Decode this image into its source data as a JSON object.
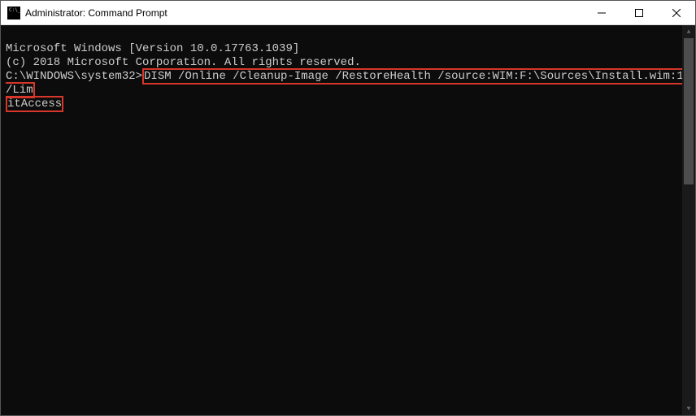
{
  "titlebar": {
    "title": "Administrator: Command Prompt"
  },
  "terminal": {
    "line1": "Microsoft Windows [Version 10.0.17763.1039]",
    "line2": "(c) 2018 Microsoft Corporation. All rights reserved.",
    "blank1": "",
    "prompt": "C:\\WINDOWS\\system32>",
    "command_part1": "DISM /Online /Cleanup-Image /RestoreHealth /source:WIM:F:\\Sources\\Install.wim:1 /Lim",
    "command_part2": "itAccess"
  }
}
